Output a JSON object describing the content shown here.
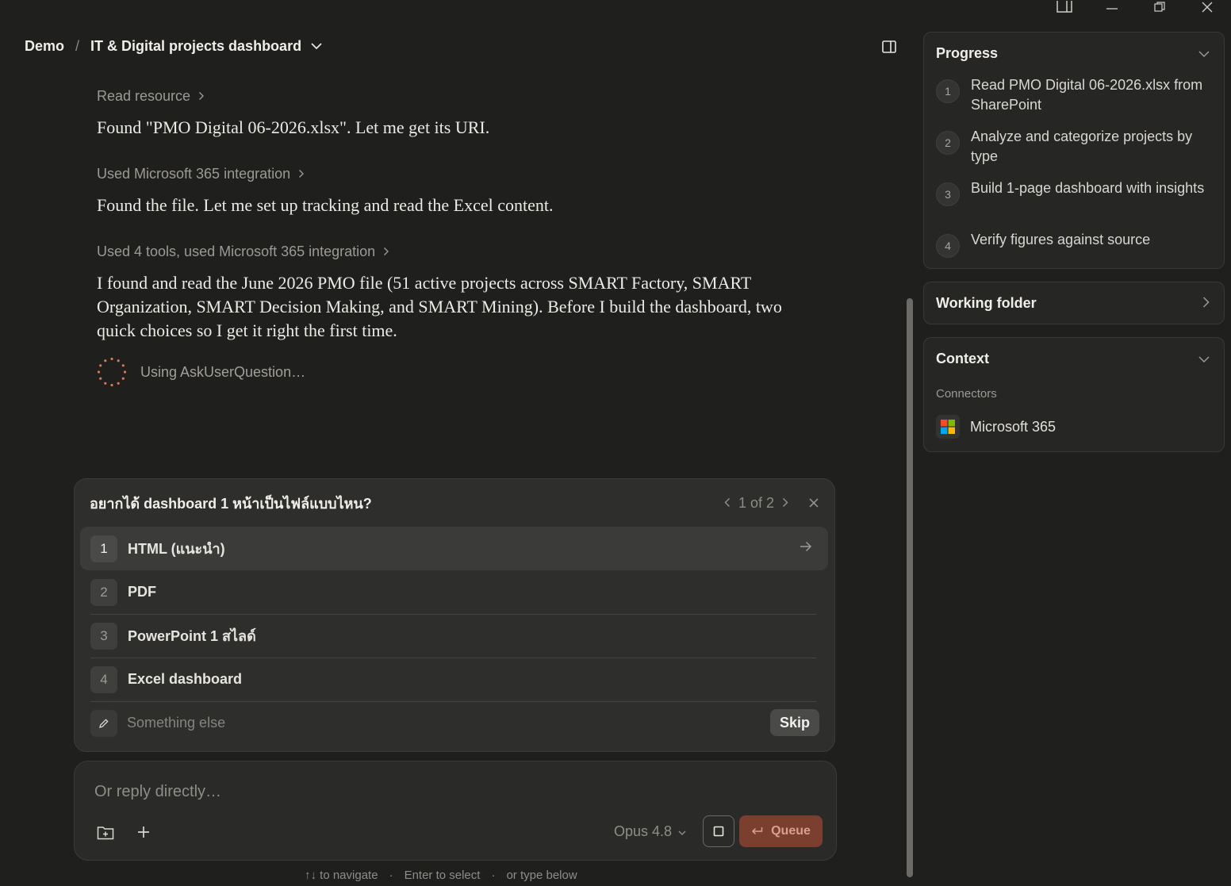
{
  "header": {
    "breadcrumb_root": "Demo",
    "breadcrumb_sep": "/",
    "project_title": "IT & Digital projects dashboard"
  },
  "chat": {
    "blocks": [
      {
        "meta": "Read resource",
        "message": "Found \"PMO Digital 06-2026.xlsx\". Let me get its URI."
      },
      {
        "meta": "Used Microsoft 365 integration",
        "message": "Found the file. Let me set up tracking and read the Excel content."
      },
      {
        "meta": "Used 4 tools, used Microsoft 365 integration",
        "message": "I found and read the June 2026 PMO file (51 active projects across SMART Factory, SMART Organization, SMART Decision Making, and SMART Mining). Before I build the dashboard, two quick choices so I get it right the first time."
      }
    ],
    "status": "Using AskUserQuestion…"
  },
  "question": {
    "title": "อยากได้ dashboard 1 หน้าเป็นไฟล์แบบไหน?",
    "pager": "1 of 2",
    "options": [
      {
        "num": "1",
        "label": "HTML (แนะนำ)"
      },
      {
        "num": "2",
        "label": "PDF"
      },
      {
        "num": "3",
        "label": "PowerPoint 1 สไลด์"
      },
      {
        "num": "4",
        "label": "Excel dashboard"
      }
    ],
    "other_placeholder": "Something else",
    "skip_label": "Skip"
  },
  "reply": {
    "placeholder": "Or reply directly…",
    "model": "Opus 4.8",
    "queue_label": "Queue"
  },
  "hint": {
    "navigate": "↑↓ to navigate",
    "sep": "·",
    "select": "Enter to select",
    "type": "or type below"
  },
  "sidebar": {
    "progress": {
      "title": "Progress",
      "steps": [
        {
          "num": "1",
          "text": "Read PMO Digital 06-2026.xlsx from SharePoint"
        },
        {
          "num": "2",
          "text": "Analyze and categorize projects by type"
        },
        {
          "num": "3",
          "text": "Build 1-page dashboard with insights"
        },
        {
          "num": "4",
          "text": "Verify figures against source"
        }
      ]
    },
    "working_folder": {
      "title": "Working folder"
    },
    "context": {
      "title": "Context",
      "connectors_label": "Connectors",
      "connector": "Microsoft 365"
    }
  },
  "colors": {
    "background": "#1f1f1e",
    "accent": "#7a3f2e",
    "spinner": "#d97757"
  }
}
